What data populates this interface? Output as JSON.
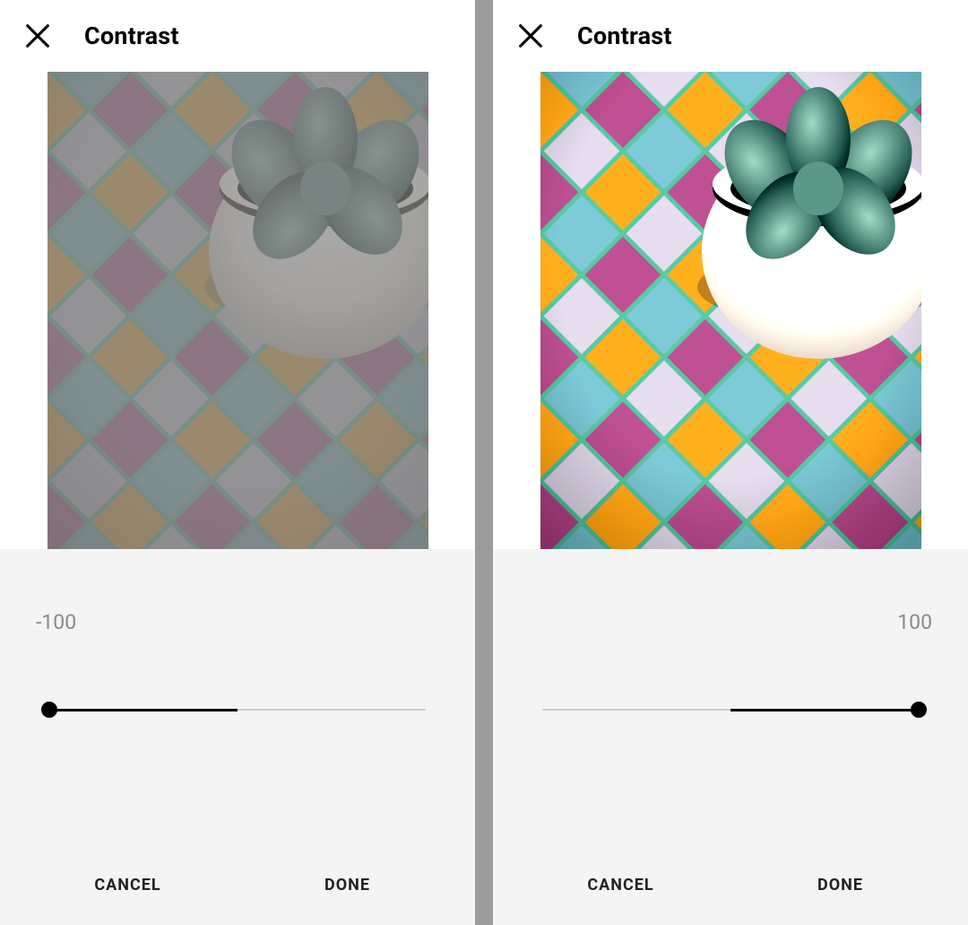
{
  "panels": [
    {
      "title": "Contrast",
      "value": "-100",
      "value_align": "left",
      "slider": {
        "min": -100,
        "max": 100,
        "position": 0,
        "center": 50
      },
      "cancel_label": "CANCEL",
      "done_label": "DONE",
      "contrast_filter": "contrast(0.36)"
    },
    {
      "title": "Contrast",
      "value": "100",
      "value_align": "right",
      "slider": {
        "min": -100,
        "max": 100,
        "position": 100,
        "center": 50
      },
      "cancel_label": "CANCEL",
      "done_label": "DONE",
      "contrast_filter": "contrast(1.85)"
    }
  ]
}
